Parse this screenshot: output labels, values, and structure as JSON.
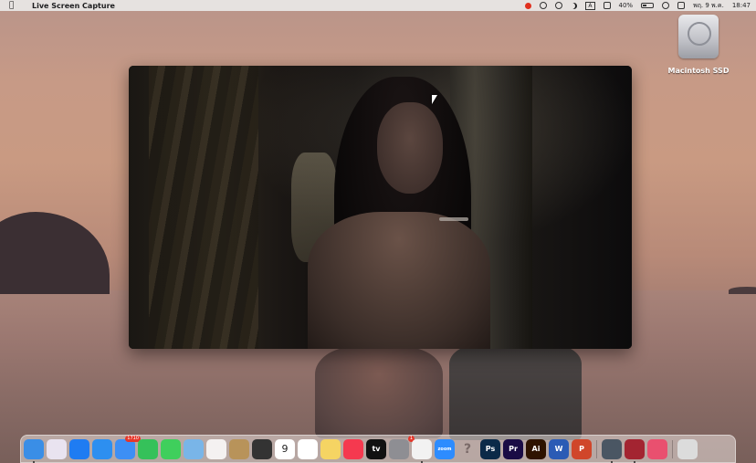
{
  "menubar": {
    "app_name": "Live Screen Capture",
    "battery_percent": "40%",
    "battery_level": 0.4,
    "date": "พฤ. 9 พ.ค.",
    "time": "18:47",
    "input_source": "A"
  },
  "desktop": {
    "drive_label": "Macintosh SSD"
  },
  "dock": {
    "items": [
      {
        "name": "finder-icon",
        "label": "",
        "color": "#3a8ee6"
      },
      {
        "name": "launchpad-icon",
        "label": "",
        "color": "#e9e3f0"
      },
      {
        "name": "app-store-icon",
        "label": "",
        "color": "#1f7cf2"
      },
      {
        "name": "safari-icon",
        "label": "",
        "color": "#2d8ff0"
      },
      {
        "name": "mail-icon",
        "label": "",
        "color": "#3d8ff5",
        "badge": "1710"
      },
      {
        "name": "facetime-icon",
        "label": "",
        "color": "#35c15a"
      },
      {
        "name": "messages-icon",
        "label": "",
        "color": "#3fcf5c"
      },
      {
        "name": "maps-icon",
        "label": "",
        "color": "#79b5e8"
      },
      {
        "name": "photos-icon",
        "label": "",
        "color": "#f4f1f1"
      },
      {
        "name": "notes-app-icon",
        "label": "",
        "color": "#b8935a"
      },
      {
        "name": "calculator-icon",
        "label": "",
        "color": "#333333"
      },
      {
        "name": "calendar-icon",
        "label": "9",
        "color": "#ffffff"
      },
      {
        "name": "reminders-icon",
        "label": "",
        "color": "#ffffff"
      },
      {
        "name": "notes-icon",
        "label": "",
        "color": "#f5d463"
      },
      {
        "name": "music-icon",
        "label": "",
        "color": "#f5394f"
      },
      {
        "name": "apple-tv-icon",
        "label": "tv",
        "color": "#111111"
      },
      {
        "name": "system-settings-icon",
        "label": "",
        "color": "#8e8e93",
        "badge": "1"
      },
      {
        "name": "chrome-icon",
        "label": "",
        "color": "#f2f2f2"
      },
      {
        "name": "zoom-icon",
        "label": "zoom",
        "color": "#2d8cff"
      },
      {
        "name": "help-icon",
        "label": "?",
        "color": "rgba(0,0,0,0)"
      },
      {
        "name": "photoshop-icon",
        "label": "Ps",
        "color": "#0b2a48"
      },
      {
        "name": "premiere-icon",
        "label": "Pr",
        "color": "#1a0c45"
      },
      {
        "name": "illustrator-icon",
        "label": "Ai",
        "color": "#2e1300"
      },
      {
        "name": "word-icon",
        "label": "W",
        "color": "#2b5bb5"
      },
      {
        "name": "powerpoint-icon",
        "label": "P",
        "color": "#d0462a"
      },
      {
        "name": "screen-capture-icon",
        "label": "",
        "color": "#4a5663"
      },
      {
        "name": "photo-booth-icon",
        "label": "",
        "color": "#a32431"
      },
      {
        "name": "creative-cloud-icon",
        "label": "",
        "color": "#e9506f"
      },
      {
        "name": "trash-icon",
        "label": "",
        "color": "#dcdcdc"
      }
    ]
  }
}
